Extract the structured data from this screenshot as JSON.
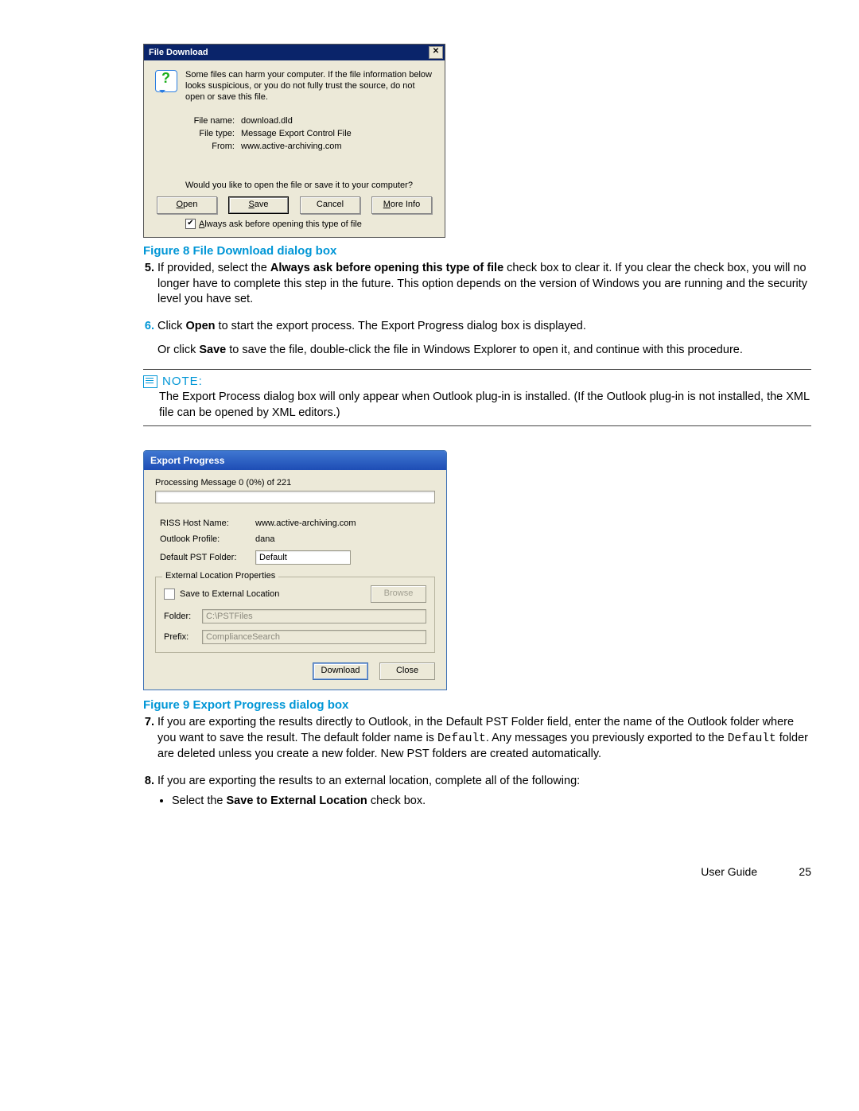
{
  "fig1": {
    "title": "File Download",
    "warn": "Some files can harm your computer. If the file information below looks suspicious, or you do not fully trust the source, do not open or save this file.",
    "kv": {
      "filename_label": "File name:",
      "filename": "download.dld",
      "filetype_label": "File type:",
      "filetype": "Message Export Control File",
      "from_label": "From:",
      "from": "www.active-archiving.com"
    },
    "question": "Would you like to open the file or save it to your computer?",
    "buttons": {
      "open": "Open",
      "save": "Save",
      "cancel": "Cancel",
      "more": "More Info"
    },
    "checkbox": "Always ask before opening this type of file",
    "caption": "Figure 8 File Download dialog box"
  },
  "steps_a": {
    "s5_a": "If provided, select the ",
    "s5_b": "Always ask before opening this type of file",
    "s5_c": " check box to clear it.  If you clear the check box, you will no longer have to complete this step in the future.  This option depends on the version of Windows you are running and the security level you have set.",
    "s6_a": "Click ",
    "s6_open": "Open",
    "s6_b": " to start the export process.  The Export Progress dialog box is displayed.",
    "s6_c": "Or click ",
    "s6_save": "Save",
    "s6_d": " to save the file, double-click the file in Windows Explorer to open it, and continue with this procedure."
  },
  "note": {
    "head": "NOTE:",
    "body": "The Export Process dialog box will only appear when Outlook plug-in is installed. (If the Outlook plug-in is not installed, the XML file can be opened by XML editors.)"
  },
  "fig2": {
    "title": "Export Progress",
    "progress": "Processing Message 0 (0%) of 221",
    "kv": {
      "host_label": "RISS Host Name:",
      "host": "www.active-archiving.com",
      "profile_label": "Outlook Profile:",
      "profile": "dana",
      "pst_label": "Default PST Folder:",
      "pst": "Default"
    },
    "group": {
      "legend": "External Location Properties",
      "save_ext": "Save to External Location",
      "browse": "Browse",
      "folder_label": "Folder:",
      "folder": "C:\\PSTFiles",
      "prefix_label": "Prefix:",
      "prefix": "ComplianceSearch"
    },
    "buttons": {
      "download": "Download",
      "close": "Close"
    },
    "caption": "Figure 9 Export Progress dialog box"
  },
  "steps_b": {
    "s7_a": "If you are exporting the results directly to Outlook, in the Default PST Folder field, enter the name of the Outlook folder where you want to save the result.  The default folder name is ",
    "s7_def": "Default",
    "s7_b": ".  Any messages you previously exported to the ",
    "s7_def2": "Default",
    "s7_c": " folder are deleted unless you create a new folder.  New PST folders are created automatically.",
    "s8": "If you are exporting the results to an external location, complete all of the following:",
    "s8_bullet_a": "Select the ",
    "s8_bullet_b": "Save to External Location",
    "s8_bullet_c": " check box."
  },
  "footer": {
    "label": "User Guide",
    "page": "25"
  }
}
